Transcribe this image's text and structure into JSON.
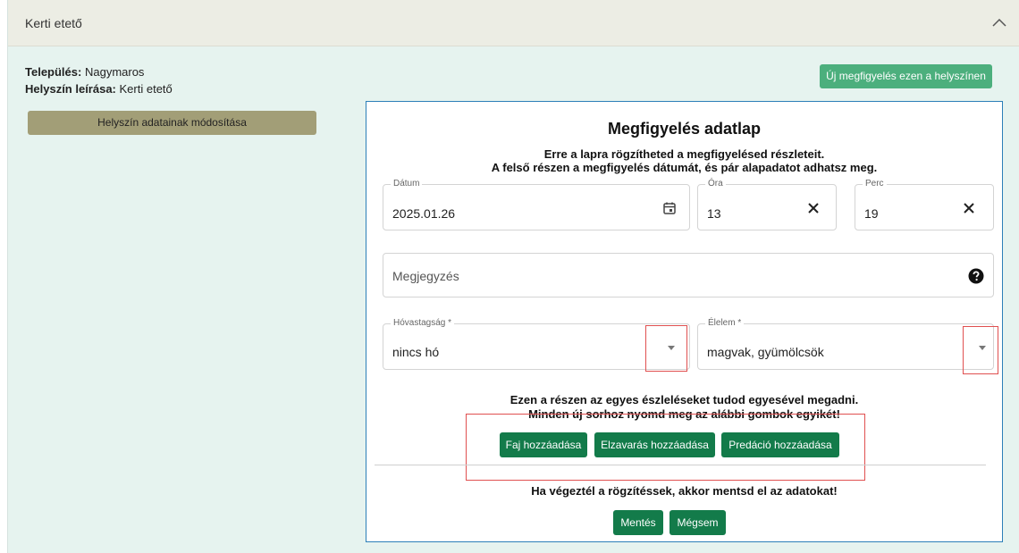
{
  "header": {
    "title": "Kerti etető"
  },
  "location": {
    "town_label": "Település:",
    "town_value": "Nagymaros",
    "desc_label": "Helyszín leírása:",
    "desc_value": "Kerti etető"
  },
  "buttons": {
    "edit_location": "Helyszín adatainak módosítása",
    "new_observation": "Új megfigyelés ezen a helyszínen"
  },
  "form": {
    "title": "Megfigyelés adatlap",
    "subtitle_1": "Erre a lapra rögzítheted a megfigyelésed részleteit.",
    "subtitle_2": "A felső részen a megfigyelés dátumát, és pár alapadatot adhatsz meg.",
    "date": {
      "label": "Dátum",
      "value": "2025.01.26"
    },
    "hour": {
      "label": "Óra",
      "value": "13"
    },
    "minute": {
      "label": "Perc",
      "value": "19"
    },
    "note": {
      "placeholder": "Megjegyzés"
    },
    "snow": {
      "label": "Hóvastagság *",
      "value": "nincs hó"
    },
    "food": {
      "label": "Élelem *",
      "value": "magvak, gyümölcsök"
    },
    "detail_text_1": "Ezen a részen az egyes észleléseket tudod egyesével megadni.",
    "detail_text_2": "Minden új sorhoz nyomd meg az alábbi gombok egyikét!",
    "add_species": "Faj hozzáadása",
    "add_disturbance": "Elzavarás hozzáadása",
    "add_predation": "Predáció hozzáadása",
    "end_text": "Ha végeztél a rögzítéssek, akkor mentsd el az adatokat!",
    "save": "Mentés",
    "cancel": "Mégsem"
  },
  "colors": {
    "panel_bg": "#e6f3ef",
    "olive_button": "#a29e77",
    "green_button": "#137b4a",
    "light_green_button": "#4caf7d",
    "form_border": "#2c7fb8",
    "highlight_box": "#e05050"
  }
}
